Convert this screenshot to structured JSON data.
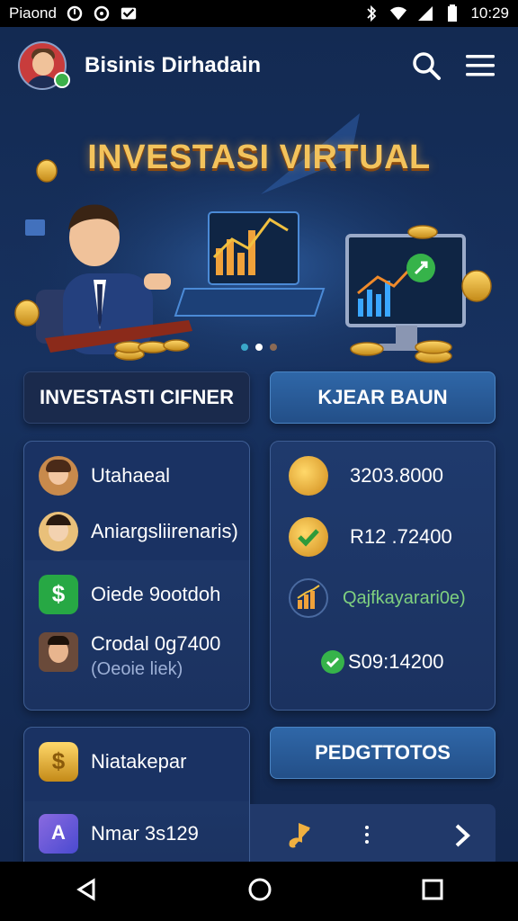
{
  "status_bar": {
    "carrier": "Piaond",
    "time": "10:29",
    "icons": [
      "circle-alert-icon",
      "circle-icon",
      "mail-icon",
      "bluetooth-icon",
      "wifi-icon",
      "signal-icon",
      "battery-icon"
    ]
  },
  "header": {
    "title": "Bisinis Dirhadain",
    "icons": [
      "search-icon",
      "menu-icon"
    ]
  },
  "banner": {
    "title": "INVESTASI VIRTUAL",
    "slide_count": 3,
    "active_slide": 2
  },
  "buttons": {
    "left_top": "INVESTASTI CIFNER",
    "right_top": "KJEAR BAUN",
    "right_bottom": "PEDGTTOTOS"
  },
  "left_panel": {
    "rows": [
      {
        "label": "Utahaeal",
        "icon": "avatar-woman-icon"
      },
      {
        "label": "Aniargsliirenaris)",
        "icon": "avatar-woman2-icon"
      },
      {
        "label": "Oiede 9ootdoh",
        "icon": "dollar-shield-icon"
      },
      {
        "label": "Crodal 0g7400",
        "sub": "(Oeoie liek)",
        "icon": "avatar-man-icon"
      }
    ]
  },
  "right_panel": {
    "rows": [
      {
        "label": "3203.8000",
        "icon": "gold-coin-icon"
      },
      {
        "label": "R12 .72400",
        "icon": "check-coin-icon"
      },
      {
        "label": "Qajfkayarari0e)",
        "icon": "chart-icon"
      },
      {
        "label": "S09:14200",
        "icon": "check-circle-icon"
      }
    ]
  },
  "bottom_left_panel": {
    "rows": [
      {
        "label": "Niatakepar",
        "icon": "gold-dollar-icon"
      },
      {
        "label": "Nmar 3s129",
        "icon": "cube-icon"
      }
    ]
  },
  "bottom_right_bar": {
    "icons": [
      "music-note-icon",
      "more-vertical-icon",
      "chevron-right-icon"
    ]
  },
  "colors": {
    "accent": "#2f67a8",
    "title_gold": "#f3c35c",
    "background": "#132a52"
  }
}
